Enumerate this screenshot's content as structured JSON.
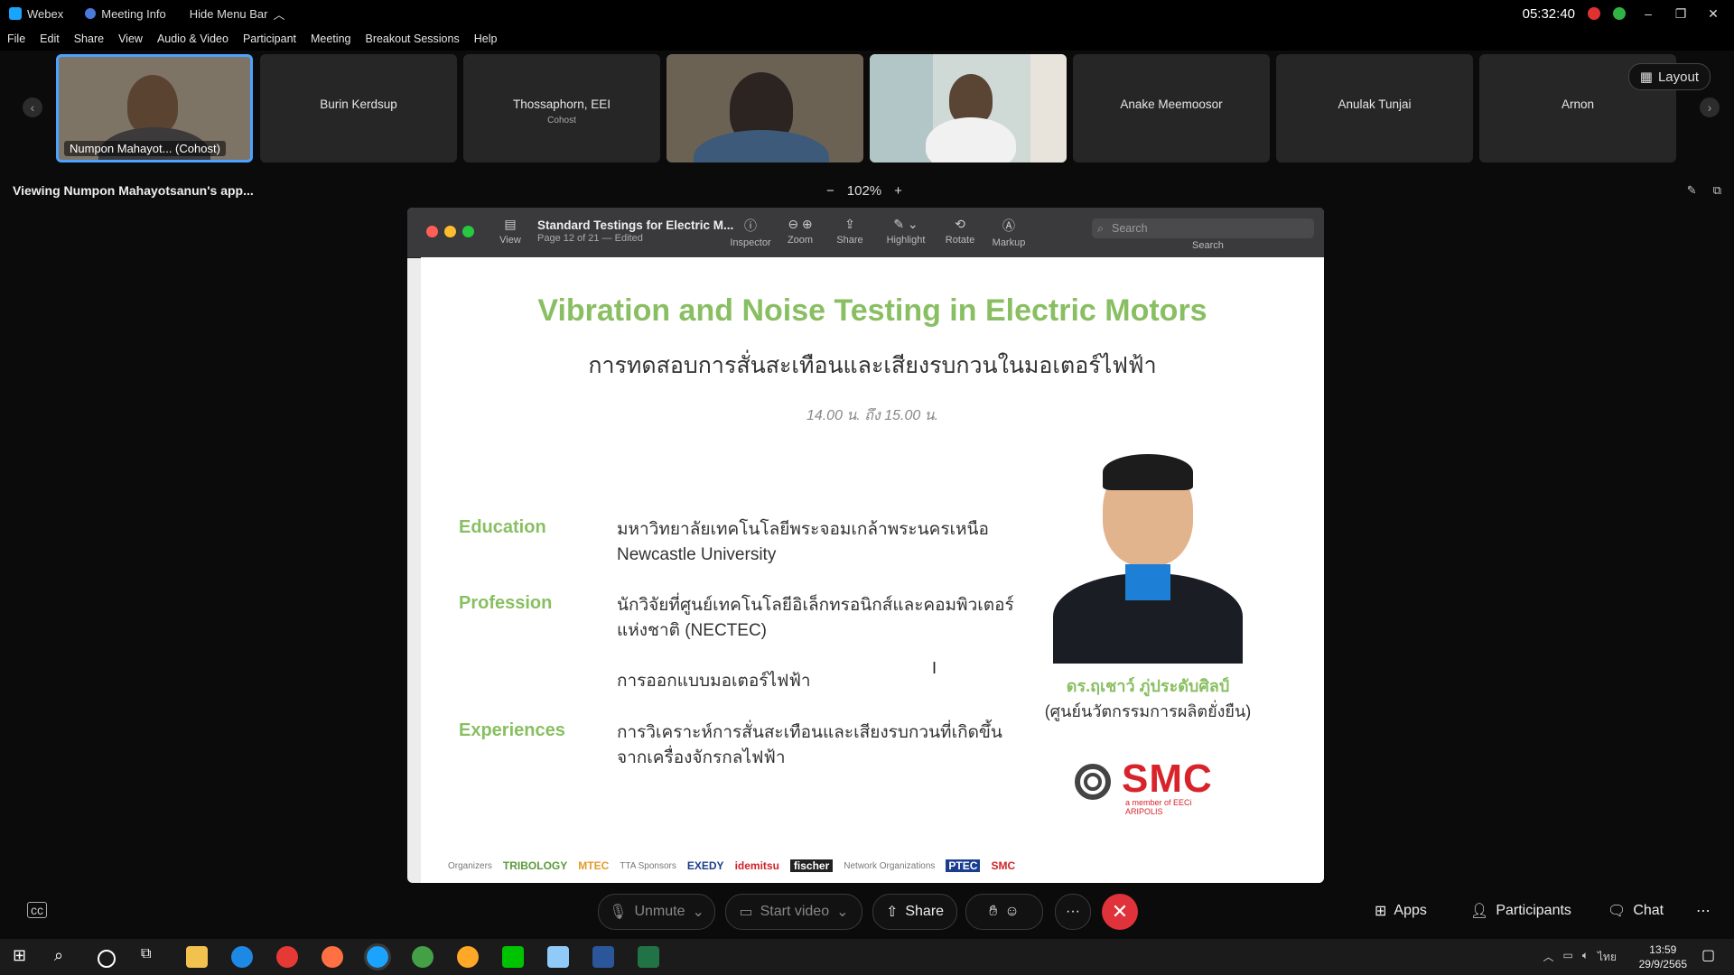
{
  "titlebar": {
    "app_name": "Webex",
    "meeting_info": "Meeting Info",
    "hide_menu": "Hide Menu Bar",
    "clock": "05:32:40"
  },
  "menu": [
    "File",
    "Edit",
    "Share",
    "View",
    "Audio & Video",
    "Participant",
    "Meeting",
    "Breakout Sessions",
    "Help"
  ],
  "participants": [
    {
      "name": "Numpon Mahayot... (Cohost)",
      "video": true
    },
    {
      "name": "Burin Kerdsup",
      "video": false
    },
    {
      "name": "Thossaphorn, EEI",
      "role": "Cohost",
      "video": false
    },
    {
      "name": "",
      "video": true
    },
    {
      "name": "",
      "video": true
    },
    {
      "name": "Anake Meemoosor",
      "video": false
    },
    {
      "name": "Anulak Tunjai",
      "video": false
    },
    {
      "name": "Arnon",
      "video": false
    }
  ],
  "layout_label": "Layout",
  "viewing": {
    "text": "Viewing Numpon Mahayotsanun's app...",
    "zoom": "102%",
    "zoom_minus": "−",
    "zoom_plus": "+"
  },
  "preview": {
    "title": "Standard Testings for Electric M...",
    "subtitle": "Page 12 of 21 — Edited",
    "tools": [
      "View",
      "Inspector",
      "Zoom",
      "Share",
      "Highlight",
      "Rotate",
      "Markup"
    ],
    "search_placeholder": "Search",
    "search_label": "Search"
  },
  "slide": {
    "title": "Vibration and Noise Testing in Electric Motors",
    "thai_title": "การทดสอบการสั่นสะเทือนและเสียงรบกวนในมอเตอร์ไฟฟ้า",
    "time": "14.00 น. ถึง 15.00 น.",
    "education_label": "Education",
    "education_text_1": "มหาวิทยาลัยเทคโนโลยีพระจอมเกล้าพระนครเหนือ",
    "education_text_2": "Newcastle University",
    "profession_label": "Profession",
    "profession_text_1": "นักวิจัยที่ศูนย์เทคโนโลยีอิเล็กทรอนิกส์และคอมพิวเตอร์",
    "profession_text_2": "แห่งชาติ (NECTEC)",
    "experience_label": "Experiences",
    "experience_text_1": "การออกแบบมอเตอร์ไฟฟ้า",
    "experience_text_2": "การวิเคราะห์การสั่นสะเทือนและเสียงรบกวนที่เกิดขึ้น",
    "experience_text_3": "จากเครื่องจักรกลไฟฟ้า",
    "speaker_name": "ดร.ฤเชาว์ ภู่ประดับศิลป์",
    "speaker_org": "(ศูนย์นวัตกรรมการผลิตยั่งยืน)",
    "smc_logo": "SMC",
    "smc_sub": "a member of EECi ARIPOLIS",
    "sponsors": [
      "Organizers",
      "TRIBOLOGY",
      "MTEC",
      "TTA Sponsors",
      "EXEDY",
      "idemitsu",
      "fischer",
      "Network Organizations",
      "PTEC",
      "SMC"
    ]
  },
  "controls": {
    "unmute": "Unmute",
    "start_video": "Start video",
    "share": "Share",
    "more": "···",
    "apps": "Apps",
    "participants": "Participants",
    "chat": "Chat"
  },
  "taskbar": {
    "time": "13:59",
    "date": "29/9/2565",
    "lang": "ไทย"
  },
  "colors": {
    "accent_green": "#89bf62",
    "end_call_red": "#e0323a",
    "active_border": "#4ba3ff"
  }
}
